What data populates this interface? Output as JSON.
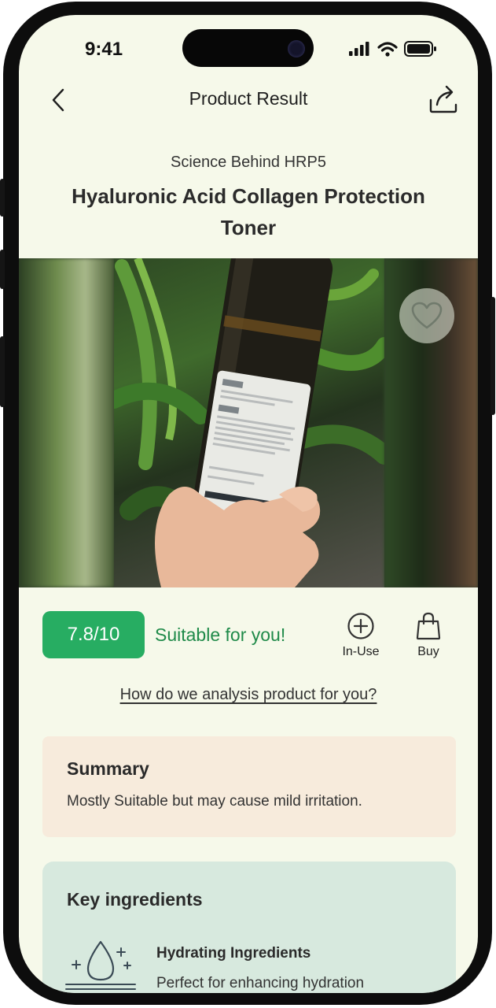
{
  "status_bar": {
    "time": "9:41"
  },
  "nav": {
    "title": "Product Result",
    "back_icon": "chevron-left-icon",
    "share_icon": "share-icon"
  },
  "product": {
    "subtitle": "Science Behind HRP5",
    "name": "Hyaluronic Acid Collagen Protection Toner",
    "favorite_icon": "heart-icon"
  },
  "result": {
    "score": "7.8/10",
    "verdict": "Suitable for you!",
    "actions": [
      {
        "label": "In-Use",
        "icon": "plus-circle-icon"
      },
      {
        "label": "Buy",
        "icon": "shopping-bag-icon"
      }
    ],
    "analysis_link": "How do we analysis product for you?"
  },
  "summary": {
    "heading": "Summary",
    "text": "Mostly Suitable but may cause mild irritation."
  },
  "key_ingredients": {
    "heading": "Key ingredients",
    "items": [
      {
        "name": "Hydrating Ingredients",
        "description": "Perfect for enhancing hydration",
        "icon": "water-drop-sparkle-icon"
      }
    ]
  },
  "colors": {
    "background": "#f6f9ea",
    "score_badge": "#27ad62",
    "verdict_text": "#1f8a49",
    "summary_card": "#f7ebdc",
    "key_card": "#d7e9de"
  }
}
